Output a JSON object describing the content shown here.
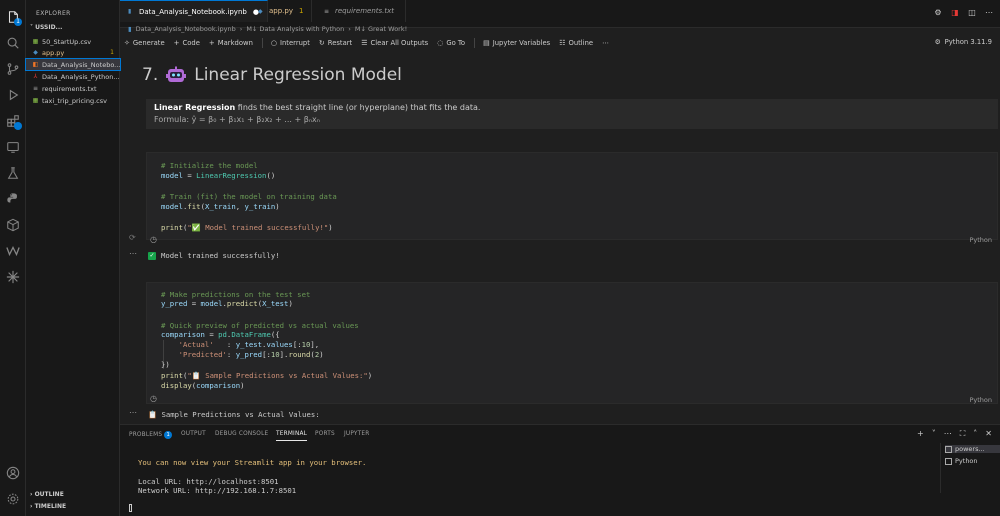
{
  "activity_bar": {
    "items": [
      "explorer-icon",
      "search-icon",
      "source-control-icon",
      "run-debug-icon",
      "extensions-icon",
      "remote-icon",
      "testing-icon",
      "python-icon",
      "package-icon",
      "wave-icon",
      "sparkle-icon"
    ],
    "explorer_badge": "1",
    "bottom": [
      "account-icon",
      "settings-icon"
    ]
  },
  "sidebar": {
    "title": "EXPLORER",
    "section": "USSID...",
    "files": [
      {
        "name": "50_StartUp.csv",
        "icon": "csv",
        "badge": ""
      },
      {
        "name": "app.py",
        "icon": "py",
        "badge": "1"
      },
      {
        "name": "Data_Analysis_Notebo...",
        "icon": "ipynb",
        "badge": ""
      },
      {
        "name": "Data_Analysis_Python...",
        "icon": "pdf",
        "badge": ""
      },
      {
        "name": "requirements.txt",
        "icon": "txt",
        "badge": ""
      },
      {
        "name": "taxi_trip_pricing.csv",
        "icon": "csv",
        "badge": ""
      }
    ],
    "outline": "OUTLINE",
    "timeline": "TIMELINE"
  },
  "tabs": [
    {
      "label": "Data_Analysis_Notebook.ipynb",
      "mod": "●"
    },
    {
      "label": "app.py",
      "mod": "1"
    },
    {
      "label": "requirements.txt",
      "mod": ""
    }
  ],
  "breadcrumb": [
    "Data_Analysis_Notebook.ipynb",
    "M↓ Data Analysis with Python",
    "M↓ Great Work!"
  ],
  "toolbar": {
    "generate": "Generate",
    "code": "Code",
    "markdown": "Markdown",
    "interrupt": "Interrupt",
    "restart": "Restart",
    "clear": "Clear All Outputs",
    "goto": "Go To",
    "jupyter_vars": "Jupyter Variables",
    "outline": "Outline",
    "kernel": "Python 3.11.9"
  },
  "notebook": {
    "heading_num": "7.",
    "heading_text": "Linear Regression Model",
    "md_bold": "Linear Regression",
    "md_rest": " finds the best straight line (or hyperplane) that fits the data.",
    "md_formula": "Formula: ŷ = β₀ + β₁x₁ + β₂x₂ + ... + βₙxₙ",
    "cell1": {
      "c1": "# Initialize the model",
      "a1": "model",
      "a2": " = ",
      "a3": "LinearRegression",
      "a4": "()",
      "c2": "# Train (fit) the model on training data",
      "b1": "model",
      "b2": ".",
      "b3": "fit",
      "b4": "(",
      "b5": "X_train",
      "b6": ", ",
      "b7": "y_train",
      "b8": ")",
      "p1": "print",
      "p2": "(",
      "p3": "\"✅ Model trained successfully!\"",
      "p4": ")",
      "lang": "Python",
      "output": "Model trained successfully!"
    },
    "cell2": {
      "c1": "# Make predictions on the test set",
      "l1a": "y_pred",
      "l1b": " = ",
      "l1c": "model",
      "l1d": ".",
      "l1e": "predict",
      "l1f": "(",
      "l1g": "X_test",
      "l1h": ")",
      "c2": "# Quick preview of predicted vs actual values",
      "l2a": "comparison",
      "l2b": " = ",
      "l2c": "pd",
      "l2d": ".",
      "l2e": "DataFrame",
      "l2f": "({",
      "l3a": "    'Actual'",
      "l3b": "   : ",
      "l3c": "y_test",
      "l3d": ".",
      "l3e": "values",
      "l3f": "[:",
      "l3g": "10",
      "l3h": "],",
      "l4a": "    'Predicted'",
      "l4b": ": ",
      "l4c": "y_pred",
      "l4d": "[:",
      "l4e": "10",
      "l4f": "].",
      "l4g": "round",
      "l4h": "(",
      "l4i": "2",
      "l4j": ")",
      "l5": "})",
      "l6a": "print",
      "l6b": "(",
      "l6c": "\"📋 Sample Predictions vs Actual Values:\"",
      "l6d": ")",
      "l7a": "display",
      "l7b": "(",
      "l7c": "comparison",
      "l7d": ")",
      "lang": "Python",
      "output": "📋 Sample Predictions vs Actual Values:"
    }
  },
  "panel": {
    "tabs": [
      "PROBLEMS",
      "OUTPUT",
      "DEBUG CONSOLE",
      "TERMINAL",
      "PORTS",
      "JUPYTER"
    ],
    "problems_badge": "1",
    "terminal": {
      "line1": "You can now view your Streamlit app in your browser.",
      "line2": "Local URL: http://localhost:8501",
      "line3": "Network URL: http://192.168.1.7:8501"
    },
    "term_list": [
      "powers...",
      "Python"
    ]
  }
}
